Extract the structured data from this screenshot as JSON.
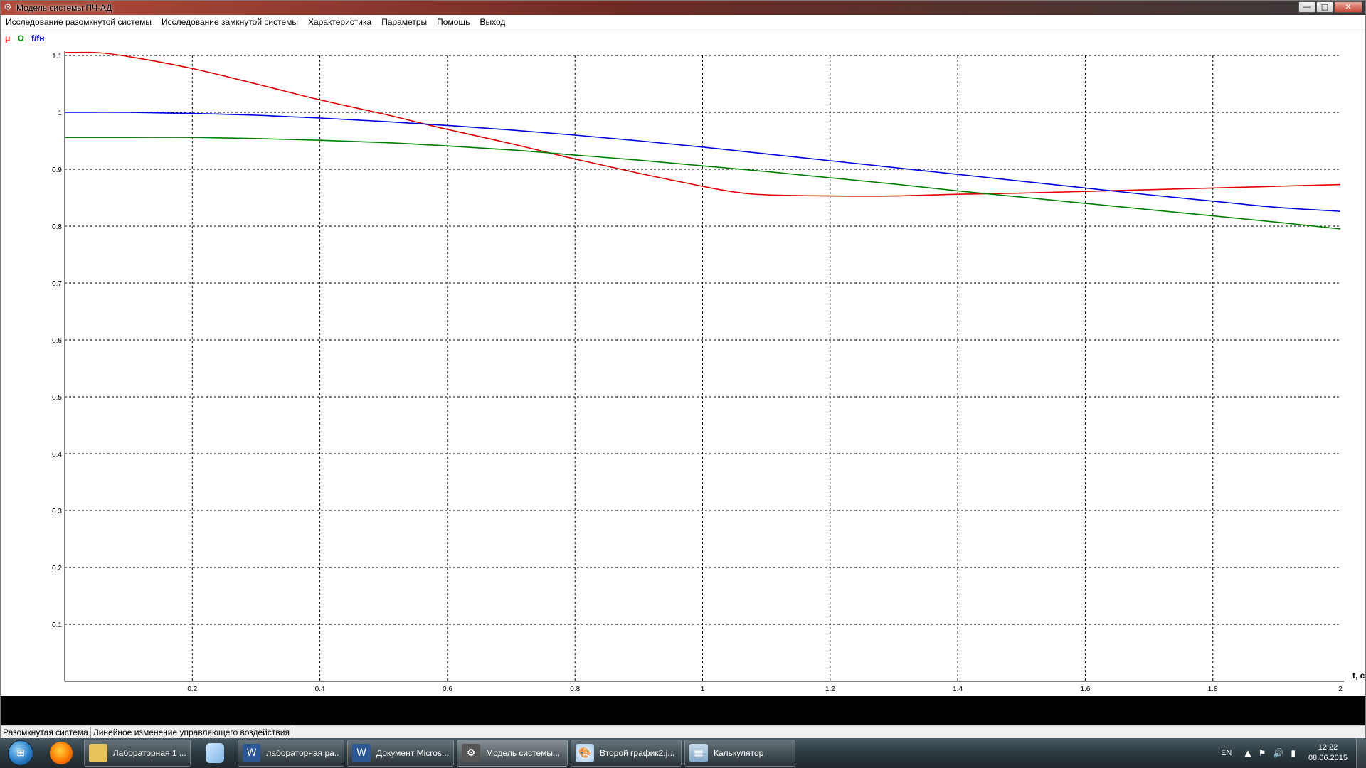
{
  "window": {
    "title": "Модель системы ПЧ-АД",
    "controls": {
      "minimize": "—",
      "maximize": "□",
      "close": "✕"
    }
  },
  "menu": [
    "Исследование разомкнутой системы",
    "Исследование замкнутой системы",
    "Характеристика",
    "Параметры",
    "Помощь",
    "Выход"
  ],
  "legend": [
    {
      "label": "μ",
      "color": "#e00000"
    },
    {
      "label": "Ω",
      "color": "#008000"
    },
    {
      "label": "f/fн",
      "color": "#0000e0"
    }
  ],
  "chart_data": {
    "type": "line",
    "xlabel": "t, c",
    "ylabel": "",
    "xlim": [
      0,
      2
    ],
    "ylim": [
      0,
      1.1
    ],
    "grid": true,
    "x_ticks": [
      "0.2",
      "0.4",
      "0.6",
      "0.8",
      "1",
      "1.2",
      "1.4",
      "1.6",
      "1.8",
      "2"
    ],
    "y_ticks": [
      "0.1",
      "0.2",
      "0.3",
      "0.4",
      "0.5",
      "0.6",
      "0.7",
      "0.8",
      "0.9",
      "1",
      "1.1"
    ],
    "series": [
      {
        "name": "μ",
        "color": "#e00000",
        "x": [
          0,
          0.05,
          0.1,
          0.2,
          0.3,
          0.4,
          0.5,
          0.6,
          0.7,
          0.8,
          0.9,
          1.0,
          1.05,
          1.1,
          1.2,
          1.3,
          1.4,
          1.5,
          1.6,
          1.7,
          1.8,
          1.9,
          2.0
        ],
        "y": [
          1.105,
          1.105,
          1.098,
          1.077,
          1.05,
          1.022,
          0.997,
          0.97,
          0.945,
          0.918,
          0.893,
          0.87,
          0.86,
          0.855,
          0.853,
          0.853,
          0.856,
          0.858,
          0.861,
          0.864,
          0.867,
          0.87,
          0.873
        ]
      },
      {
        "name": "Ω",
        "color": "#008000",
        "x": [
          0,
          0.1,
          0.2,
          0.3,
          0.4,
          0.5,
          0.6,
          0.7,
          0.8,
          0.9,
          1.0,
          1.1,
          1.2,
          1.3,
          1.4,
          1.5,
          1.6,
          1.7,
          1.8,
          1.9,
          2.0
        ],
        "y": [
          0.956,
          0.956,
          0.956,
          0.954,
          0.951,
          0.947,
          0.941,
          0.934,
          0.925,
          0.916,
          0.906,
          0.896,
          0.885,
          0.874,
          0.862,
          0.851,
          0.84,
          0.829,
          0.818,
          0.807,
          0.795
        ]
      },
      {
        "name": "f/fн",
        "color": "#0000e0",
        "x": [
          0,
          0.1,
          0.2,
          0.3,
          0.4,
          0.5,
          0.6,
          0.7,
          0.8,
          0.9,
          1.0,
          1.1,
          1.2,
          1.3,
          1.4,
          1.5,
          1.6,
          1.7,
          1.8,
          1.9,
          2.0
        ],
        "y": [
          1.0,
          1.0,
          0.998,
          0.995,
          0.99,
          0.984,
          0.977,
          0.969,
          0.96,
          0.95,
          0.939,
          0.927,
          0.915,
          0.903,
          0.891,
          0.879,
          0.867,
          0.855,
          0.844,
          0.833,
          0.826
        ]
      }
    ]
  },
  "status": {
    "mode": "Разомкнутая система",
    "description": "Линейное изменение управляющего воздействия"
  },
  "taskbar": {
    "items": [
      {
        "label": "Лабораторная 1 ...",
        "icon": "folder-icon"
      },
      {
        "label": "лабораторная ра...",
        "icon": "word-icon"
      },
      {
        "label": "Документ Micros...",
        "icon": "word-icon"
      },
      {
        "label": "Модель системы...",
        "icon": "gear-icon",
        "active": true
      },
      {
        "label": "Второй график2.j...",
        "icon": "paint-icon"
      },
      {
        "label": "Калькулятор",
        "icon": "calculator-icon"
      }
    ],
    "lang": "EN",
    "time": "12:22",
    "date": "08.06.2015"
  }
}
